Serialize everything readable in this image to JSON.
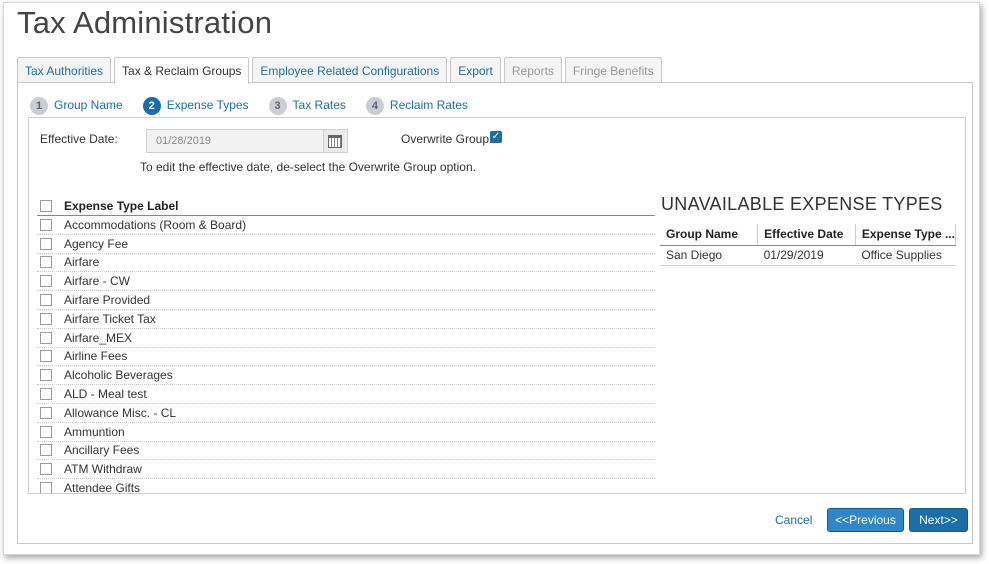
{
  "page": {
    "title": "Tax Administration"
  },
  "tabs": [
    {
      "label": "Tax Authorities",
      "state": "normal"
    },
    {
      "label": "Tax & Reclaim Groups",
      "state": "active"
    },
    {
      "label": "Employee Related Configurations",
      "state": "normal"
    },
    {
      "label": "Export",
      "state": "normal"
    },
    {
      "label": "Reports",
      "state": "disabled"
    },
    {
      "label": "Fringe Benefits",
      "state": "disabled"
    }
  ],
  "steps": [
    {
      "num": "1",
      "label": "Group Name"
    },
    {
      "num": "2",
      "label": "Expense Types"
    },
    {
      "num": "3",
      "label": "Tax Rates"
    },
    {
      "num": "4",
      "label": "Reclaim Rates"
    }
  ],
  "form": {
    "effective_date_label": "Effective Date:",
    "effective_date_value": "01/28/2019",
    "overwrite_label": "Overwrite Group:",
    "overwrite_checked": true,
    "hint": "To edit the effective date, de-select the Overwrite Group option."
  },
  "expense_list": {
    "header": "Expense Type Label",
    "items": [
      "Accommodations (Room & Board)",
      "Agency Fee",
      "Airfare",
      "Airfare - CW",
      "Airfare Provided",
      "Airfare Ticket Tax",
      "Airfare_MEX",
      "Airline Fees",
      "Alcoholic Beverages",
      "ALD - Meal test",
      "Allowance Misc. - CL",
      "Ammuntion",
      "Ancillary Fees",
      "ATM Withdraw",
      "Attendee Gifts"
    ]
  },
  "unavailable": {
    "title": "UNAVAILABLE EXPENSE TYPES",
    "columns": [
      "Group Name",
      "Effective Date",
      "Expense Type ..."
    ],
    "rows": [
      [
        "San Diego",
        "01/29/2019",
        "Office Supplies"
      ]
    ]
  },
  "footer": {
    "cancel": "Cancel",
    "previous": "<<Previous",
    "next": "Next>>"
  },
  "colors": {
    "accent": "#1b6ea8",
    "disabled_text": "#999999",
    "step_inactive": "#c9ced4"
  }
}
